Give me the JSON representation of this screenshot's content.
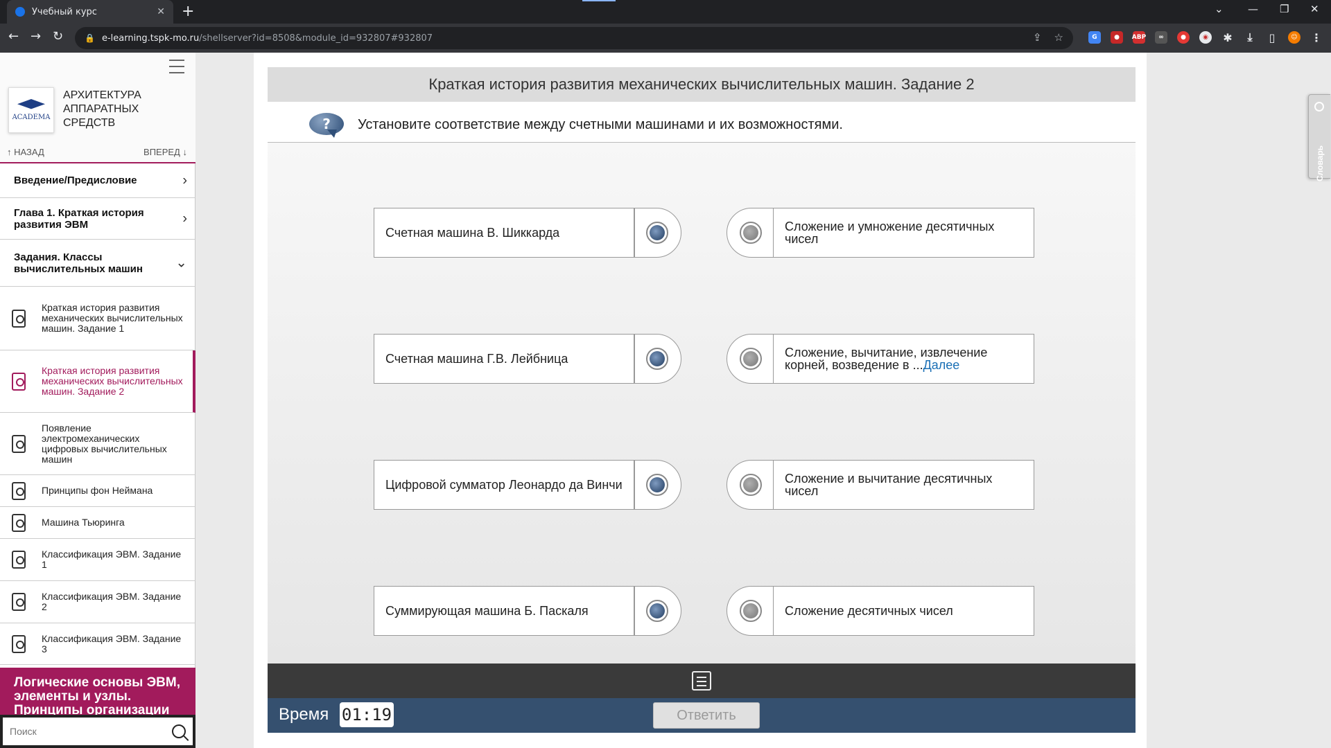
{
  "browser": {
    "tab_title": "Учебный курс",
    "url_host": "e-learning.tspk-mo.ru",
    "url_path": "/shellserver?id=8508&module_id=932807#932807"
  },
  "sidebar": {
    "logo_text": "ACADEMA",
    "course_title": "Архитектура аппаратных средств",
    "nav_prev": "НАЗАД",
    "nav_next": "ВПЕРЕД",
    "chapters": [
      {
        "label": "Введение/Предисловие"
      },
      {
        "label": "Глава 1. Краткая история развития ЭВМ"
      },
      {
        "label": "Задания. Классы вычислительных машин"
      }
    ],
    "lessons": [
      {
        "label": "Краткая история развития механических вычислительных машин. Задание 1"
      },
      {
        "label": "Краткая история развития механических вычислительных машин. Задание 2"
      },
      {
        "label": "Появление электромеханических цифровых вычислительных машин"
      },
      {
        "label": "Принципы фон Неймана"
      },
      {
        "label": "Машина Тьюринга"
      },
      {
        "label": "Классификация ЭВМ. Задание 1"
      },
      {
        "label": "Классификация ЭВМ. Задание 2"
      },
      {
        "label": "Классификация ЭВМ. Задание 3"
      }
    ],
    "bottom_chapter": "Логические основы ЭВМ, элементы и узлы. Принципы организации",
    "search_placeholder": "Поиск"
  },
  "task": {
    "title": "Краткая история развития механических вычислительных машин. Задание 2",
    "question": "Установите соответствие между счетными машинами и их возможностями.",
    "left_items": [
      "Счетная машина В. Шиккарда",
      "Счетная машина Г.В. Лейбница",
      "Цифровой сумматор Леонардо да Винчи",
      "Суммирующая машина Б. Паскаля"
    ],
    "right_items": [
      {
        "text": "Сложение и умножение десятичных чисел",
        "more": ""
      },
      {
        "text": "Сложение, вычитание, извлечение корней, возведение в ...",
        "more": "Далее"
      },
      {
        "text": "Сложение и вычитание десятичных чисел",
        "more": ""
      },
      {
        "text": "Сложение десятичных чисел",
        "more": ""
      }
    ],
    "time_label": "Время",
    "time_value": "01:19",
    "answer_button": "Ответить",
    "glossary_label": "Словарь"
  }
}
